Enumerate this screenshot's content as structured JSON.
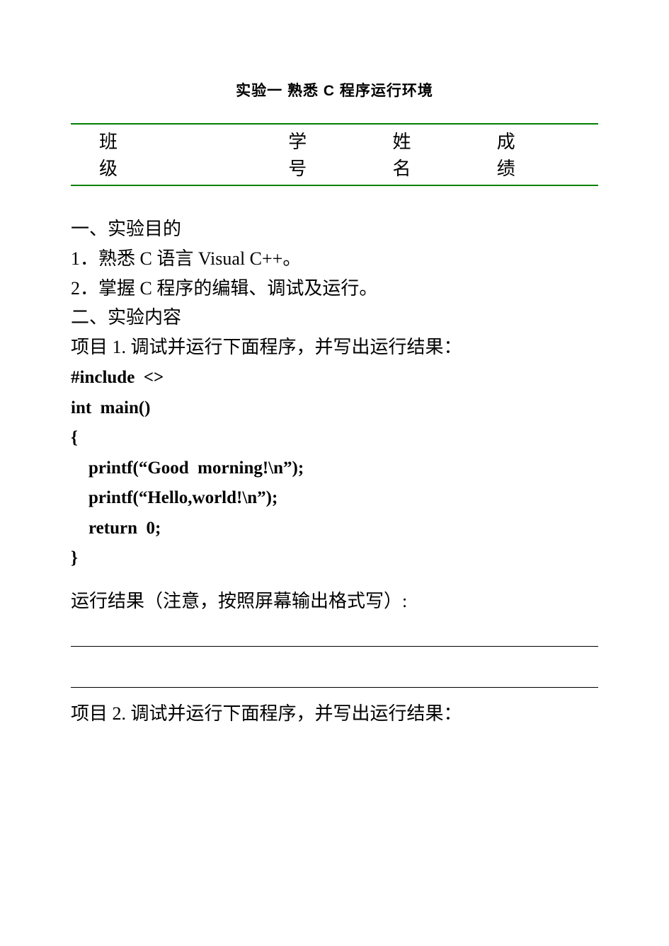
{
  "title": "实验一 熟悉 C 程序运行环境",
  "table": {
    "h1a": "班",
    "h1b": "级",
    "h2a": "学",
    "h2b": "号",
    "h3a": "姓",
    "h3b": "名",
    "h4a": "成",
    "h4b": "绩"
  },
  "section1": {
    "heading": "一、实验目的",
    "item1": "1．熟悉 C 语言 Visual C++。",
    "item2": "2．掌握 C 程序的编辑、调试及运行。"
  },
  "section2": {
    "heading": "二、实验内容",
    "project1_label": "项目 1. 调试并运行下面程序，并写出运行结果：",
    "code1": "#include  <>\nint  main()\n{\n    printf(“Good  morning!\\n”);\n    printf(“Hello,world!\\n”);\n    return  0;\n}",
    "result_label": "运行结果（注意，按照屏幕输出格式写）:",
    "project2_label": "项目 2. 调试并运行下面程序，并写出运行结果："
  }
}
